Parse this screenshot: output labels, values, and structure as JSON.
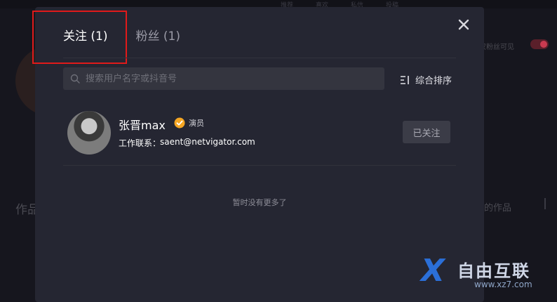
{
  "background": {
    "nav_items": [
      "推荐",
      "喜欢",
      "私信",
      "投稿"
    ],
    "works_label": "作品",
    "right_text": "仅粉丝可见",
    "right_text2": "的作品"
  },
  "modal": {
    "tabs": [
      {
        "label": "关注 (1)",
        "active": true
      },
      {
        "label": "粉丝 (1)",
        "active": false
      }
    ],
    "close_icon": "close-icon",
    "search": {
      "placeholder": "搜索用户名字或抖音号",
      "value": ""
    },
    "sort_label": "综合排序",
    "users": [
      {
        "name": "张晋max",
        "badge": "演员",
        "contact_label": "工作联系：",
        "contact_value": "saent@netvigator.com",
        "follow_status": "已关注"
      }
    ],
    "no_more_text": "暂时没有更多了"
  },
  "watermark": {
    "brand": "自由互联",
    "url": "www.xz7.com"
  },
  "colors": {
    "highlight": "#e01a1a",
    "badge": "#f5a623",
    "modal_bg": "#252632"
  }
}
